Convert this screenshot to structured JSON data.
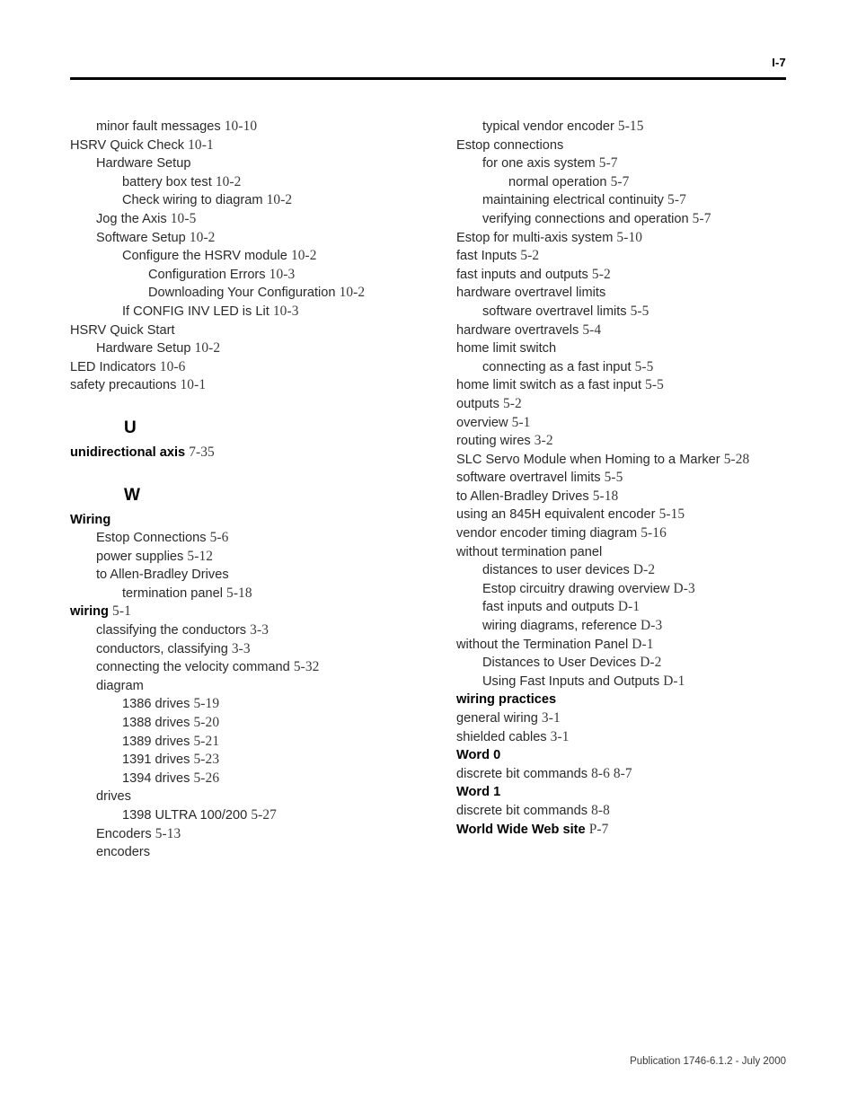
{
  "header": {
    "folio": "I-7"
  },
  "footer": {
    "publication": "Publication 1746-6.1.2 - July 2000"
  },
  "columns": [
    {
      "name": "left-column",
      "blocks": [
        {
          "type": "entry",
          "level": 1,
          "bold": false,
          "text": "minor fault messages",
          "page": "10-10"
        },
        {
          "type": "entry",
          "level": 0,
          "bold": false,
          "text": "HSRV Quick Check",
          "page": "10-1"
        },
        {
          "type": "entry",
          "level": 1,
          "bold": false,
          "text": "Hardware Setup",
          "page": ""
        },
        {
          "type": "entry",
          "level": 2,
          "bold": false,
          "text": "battery box test",
          "page": "10-2"
        },
        {
          "type": "entry",
          "level": 2,
          "bold": false,
          "text": "Check wiring to diagram",
          "page": "10-2"
        },
        {
          "type": "entry",
          "level": 1,
          "bold": false,
          "text": "Jog the Axis",
          "page": "10-5"
        },
        {
          "type": "entry",
          "level": 1,
          "bold": false,
          "text": "Software Setup",
          "page": "10-2"
        },
        {
          "type": "entry",
          "level": 2,
          "bold": false,
          "text": "Configure the HSRV module",
          "page": "10-2"
        },
        {
          "type": "entry",
          "level": 3,
          "bold": false,
          "text": "Configuration Errors",
          "page": "10-3"
        },
        {
          "type": "entry",
          "level": 3,
          "bold": false,
          "text": "Downloading Your Configuration",
          "page": "10-2"
        },
        {
          "type": "entry",
          "level": 2,
          "bold": false,
          "text": "If CONFIG INV LED is Lit",
          "page": "10-3"
        },
        {
          "type": "entry",
          "level": 0,
          "bold": false,
          "text": "HSRV Quick Start",
          "page": ""
        },
        {
          "type": "entry",
          "level": 1,
          "bold": false,
          "text": "Hardware Setup",
          "page": "10-2"
        },
        {
          "type": "entry",
          "level": 0,
          "bold": false,
          "text": "LED Indicators",
          "page": "10-6"
        },
        {
          "type": "entry",
          "level": 0,
          "bold": false,
          "text": "safety precautions",
          "page": "10-1"
        },
        {
          "type": "letter",
          "text": "U"
        },
        {
          "type": "entry",
          "level": 0,
          "bold": true,
          "text": "unidirectional axis",
          "page": "7-35"
        },
        {
          "type": "letter",
          "text": "W"
        },
        {
          "type": "entry",
          "level": 0,
          "bold": true,
          "text": "Wiring",
          "page": ""
        },
        {
          "type": "entry",
          "level": 1,
          "bold": false,
          "text": "Estop Connections",
          "page": "5-6"
        },
        {
          "type": "entry",
          "level": 1,
          "bold": false,
          "text": "power supplies",
          "page": "5-12"
        },
        {
          "type": "entry",
          "level": 1,
          "bold": false,
          "text": "to Allen-Bradley Drives",
          "page": ""
        },
        {
          "type": "entry",
          "level": 2,
          "bold": false,
          "text": "termination panel",
          "page": "5-18"
        },
        {
          "type": "entry",
          "level": 0,
          "bold": true,
          "text": "wiring",
          "page": "5-1"
        },
        {
          "type": "entry",
          "level": 1,
          "bold": false,
          "text": "classifying the conductors",
          "page": "3-3"
        },
        {
          "type": "entry",
          "level": 1,
          "bold": false,
          "text": "conductors, classifying",
          "page": "3-3"
        },
        {
          "type": "entry",
          "level": 1,
          "bold": false,
          "text": "connecting the velocity command",
          "page": "5-32"
        },
        {
          "type": "entry",
          "level": 1,
          "bold": false,
          "text": "diagram",
          "page": ""
        },
        {
          "type": "entry",
          "level": 2,
          "bold": false,
          "text": "1386 drives",
          "page": "5-19"
        },
        {
          "type": "entry",
          "level": 2,
          "bold": false,
          "text": "1388 drives",
          "page": "5-20"
        },
        {
          "type": "entry",
          "level": 2,
          "bold": false,
          "text": "1389 drives",
          "page": "5-21"
        },
        {
          "type": "entry",
          "level": 2,
          "bold": false,
          "text": "1391 drives",
          "page": "5-23"
        },
        {
          "type": "entry",
          "level": 2,
          "bold": false,
          "text": "1394 drives",
          "page": "5-26"
        },
        {
          "type": "entry",
          "level": 1,
          "bold": false,
          "text": "drives",
          "page": ""
        },
        {
          "type": "entry",
          "level": 2,
          "bold": false,
          "text": "1398 ULTRA 100/200",
          "page": "5-27"
        },
        {
          "type": "entry",
          "level": 1,
          "bold": false,
          "text": "Encoders",
          "page": "5-13"
        },
        {
          "type": "entry",
          "level": 1,
          "bold": false,
          "text": "encoders",
          "page": ""
        }
      ]
    },
    {
      "name": "right-column",
      "blocks": [
        {
          "type": "entry",
          "level": 1,
          "bold": false,
          "text": "typical vendor encoder",
          "page": "5-15"
        },
        {
          "type": "entry",
          "level": 0,
          "bold": false,
          "text": "Estop connections",
          "page": ""
        },
        {
          "type": "entry",
          "level": 1,
          "bold": false,
          "text": "for one axis system",
          "page": "5-7"
        },
        {
          "type": "entry",
          "level": 2,
          "bold": false,
          "text": "normal operation",
          "page": "5-7"
        },
        {
          "type": "entry",
          "level": 1,
          "bold": false,
          "text": "maintaining electrical continuity",
          "page": "5-7"
        },
        {
          "type": "entry",
          "level": 1,
          "bold": false,
          "text": "verifying connections and operation",
          "page": "5-7"
        },
        {
          "type": "entry",
          "level": 0,
          "bold": false,
          "text": "Estop for multi-axis system",
          "page": "5-10"
        },
        {
          "type": "entry",
          "level": 0,
          "bold": false,
          "text": "fast Inputs",
          "page": "5-2"
        },
        {
          "type": "entry",
          "level": 0,
          "bold": false,
          "text": "fast inputs and outputs",
          "page": "5-2"
        },
        {
          "type": "entry",
          "level": 0,
          "bold": false,
          "text": "hardware overtravel limits",
          "page": ""
        },
        {
          "type": "entry",
          "level": 1,
          "bold": false,
          "text": "software overtravel limits",
          "page": "5-5"
        },
        {
          "type": "entry",
          "level": 0,
          "bold": false,
          "text": "hardware overtravels",
          "page": "5-4"
        },
        {
          "type": "entry",
          "level": 0,
          "bold": false,
          "text": "home limit switch",
          "page": ""
        },
        {
          "type": "entry",
          "level": 1,
          "bold": false,
          "text": "connecting as a fast input",
          "page": "5-5"
        },
        {
          "type": "entry",
          "level": 0,
          "bold": false,
          "text": "home limit switch as a fast input",
          "page": "5-5"
        },
        {
          "type": "entry",
          "level": 0,
          "bold": false,
          "text": "outputs",
          "page": "5-2"
        },
        {
          "type": "entry",
          "level": 0,
          "bold": false,
          "text": "overview",
          "page": "5-1"
        },
        {
          "type": "entry",
          "level": 0,
          "bold": false,
          "text": "routing wires",
          "page": "3-2"
        },
        {
          "type": "entry",
          "level": 0,
          "bold": false,
          "text": "SLC Servo Module when Homing to a Marker",
          "page": "5-28"
        },
        {
          "type": "entry",
          "level": 0,
          "bold": false,
          "text": "software overtravel limits",
          "page": "5-5"
        },
        {
          "type": "entry",
          "level": 0,
          "bold": false,
          "text": "to Allen-Bradley Drives",
          "page": "5-18"
        },
        {
          "type": "entry",
          "level": 0,
          "bold": false,
          "text": "using an 845H equivalent encoder",
          "page": "5-15"
        },
        {
          "type": "entry",
          "level": 0,
          "bold": false,
          "text": "vendor encoder timing diagram",
          "page": "5-16"
        },
        {
          "type": "entry",
          "level": 0,
          "bold": false,
          "text": "without termination panel",
          "page": ""
        },
        {
          "type": "entry",
          "level": 1,
          "bold": false,
          "text": "distances to user devices",
          "page": "D-2"
        },
        {
          "type": "entry",
          "level": 1,
          "bold": false,
          "text": "Estop circuitry drawing overview",
          "page": "D-3"
        },
        {
          "type": "entry",
          "level": 1,
          "bold": false,
          "text": "fast inputs and outputs",
          "page": "D-1"
        },
        {
          "type": "entry",
          "level": 1,
          "bold": false,
          "text": "wiring diagrams, reference",
          "page": "D-3"
        },
        {
          "type": "entry",
          "level": 0,
          "bold": false,
          "text": "without the Termination Panel",
          "page": "D-1"
        },
        {
          "type": "entry",
          "level": 1,
          "bold": false,
          "text": "Distances to User Devices",
          "page": "D-2"
        },
        {
          "type": "entry",
          "level": 1,
          "bold": false,
          "text": "Using Fast Inputs and Outputs",
          "page": "D-1"
        },
        {
          "type": "entry",
          "level": -1,
          "bold": true,
          "text": "wiring practices",
          "page": ""
        },
        {
          "type": "entry",
          "level": 0,
          "bold": false,
          "text": "general wiring",
          "page": "3-1"
        },
        {
          "type": "entry",
          "level": 0,
          "bold": false,
          "text": "shielded cables",
          "page": "3-1"
        },
        {
          "type": "entry",
          "level": -1,
          "bold": true,
          "text": "Word 0",
          "page": ""
        },
        {
          "type": "entry",
          "level": 0,
          "bold": false,
          "text": "discrete bit commands",
          "page": "8-6  8-7"
        },
        {
          "type": "entry",
          "level": -1,
          "bold": true,
          "text": "Word 1",
          "page": ""
        },
        {
          "type": "entry",
          "level": 0,
          "bold": false,
          "text": "discrete bit commands",
          "page": "8-8"
        },
        {
          "type": "entry",
          "level": -1,
          "bold": true,
          "text": "World Wide Web site",
          "page": "P-7"
        }
      ]
    }
  ]
}
